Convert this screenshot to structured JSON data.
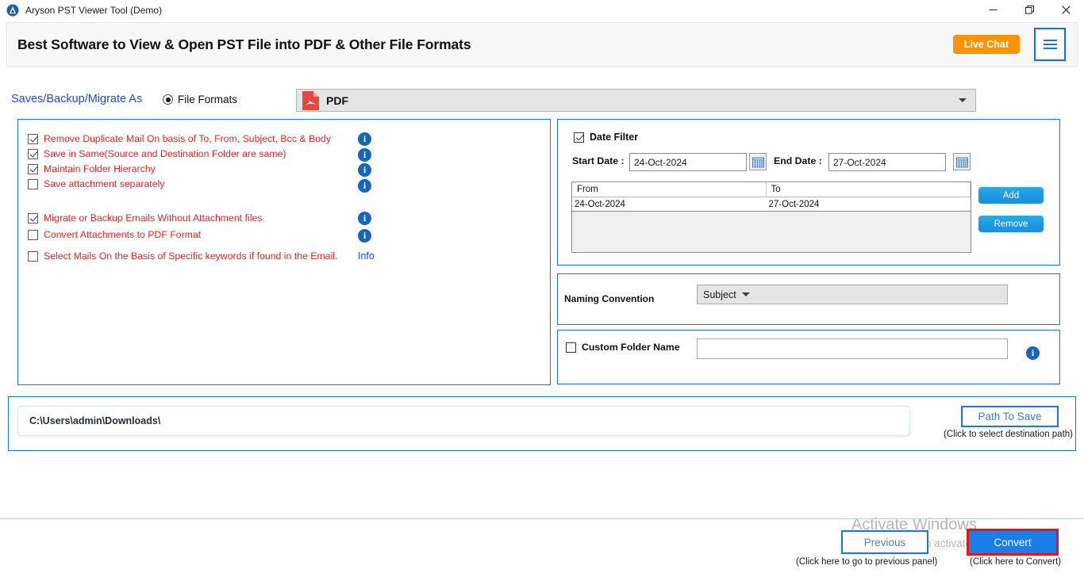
{
  "window": {
    "title": "Aryson PST Viewer Tool (Demo)",
    "app_icon": "aryson-logo-icon",
    "controls": {
      "minimize": "minimize-icon",
      "maximize": "restore-icon",
      "close": "close-icon"
    }
  },
  "header": {
    "title": "Best Software to View & Open PST File into PDF & Other File Formats",
    "live_chat_label": "Live Chat",
    "menu_icon": "hamburger-menu-icon"
  },
  "format_row": {
    "saves_label": "Saves/Backup/Migrate As",
    "radio_label": "File Formats",
    "radio_selected": true,
    "format_value": "PDF",
    "format_icon": "pdf-file-icon"
  },
  "options": {
    "group1": [
      {
        "label": "Remove Duplicate Mail On basis of To, From, Subject, Bcc & Body",
        "checked": true,
        "info": "info-icon"
      },
      {
        "label": "Save in Same(Source and Destination Folder are same)",
        "checked": true,
        "info": "info-icon"
      },
      {
        "label": "Maintain Folder Hierarchy",
        "checked": true,
        "info": "info-icon"
      },
      {
        "label": "Save attachment separately",
        "checked": false,
        "info": "info-icon"
      }
    ],
    "group2": [
      {
        "label": "Migrate or Backup Emails Without Attachment files",
        "checked": true,
        "info": "info-icon"
      },
      {
        "label": "Convert Attachments to PDF Format",
        "checked": false,
        "info": "info-icon"
      }
    ],
    "keyword_option": {
      "label": "Select Mails On the Basis of Specific keywords if found in the Email.",
      "checked": false,
      "info_label": "Info"
    }
  },
  "date_filter": {
    "title": "Date Filter",
    "checked": true,
    "start_label": "Start Date :",
    "start_value": "24-Oct-2024",
    "end_label": "End Date :",
    "end_value": "27-Oct-2024",
    "calendar_icon": "calendar-icon",
    "table": {
      "columns": [
        "From",
        "To"
      ],
      "rows": [
        [
          "24-Oct-2024",
          "27-Oct-2024"
        ]
      ]
    },
    "add_label": "Add",
    "remove_label": "Remove"
  },
  "naming": {
    "label": "Naming Convention",
    "value": "Subject"
  },
  "custom_folder": {
    "label": "Custom Folder Name",
    "checked": false,
    "value": "",
    "placeholder": "",
    "info": "info-icon"
  },
  "path": {
    "value": "C:\\Users\\admin\\Downloads\\",
    "button_label": "Path To Save",
    "hint": "(Click to select destination path)"
  },
  "footer": {
    "previous_label": "Previous",
    "previous_hint": "(Click here to go to previous panel)",
    "convert_label": "Convert",
    "convert_hint": "(Click here to Convert)"
  },
  "watermark": {
    "title": "Activate Windows",
    "subtitle": "Go to Settings to activate Windows."
  },
  "colors": {
    "accent_blue": "#1a73e8",
    "option_red": "#ee2222",
    "live_chat_orange": "#f89406",
    "convert_blue": "#1a7ee8",
    "convert_border_red": "#ee1111",
    "link_blue": "#1b4fd8"
  }
}
